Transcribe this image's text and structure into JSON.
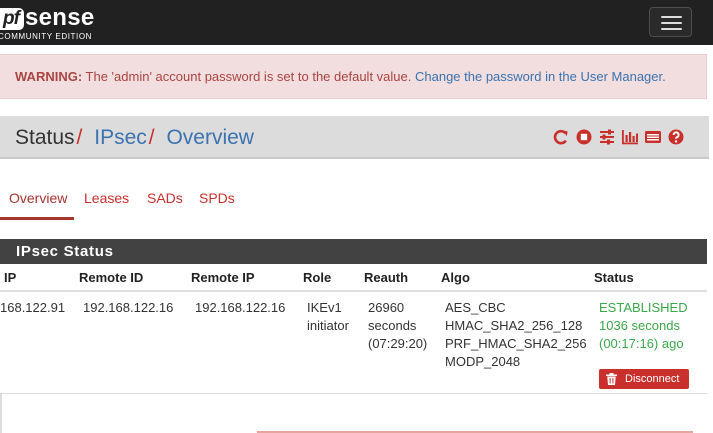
{
  "brand": {
    "logo_pf": "pf",
    "logo_sense": "sense",
    "edition": "COMMUNITY EDITION"
  },
  "alert": {
    "label": "WARNING:",
    "message": " The 'admin' account password is set to the default value. ",
    "link": "Change the password in the User Manager."
  },
  "breadcrumb": {
    "items": [
      "Status",
      "IPsec",
      "Overview"
    ],
    "separator": "/"
  },
  "toolbar": {
    "icons": [
      "reload-icon",
      "stop-icon",
      "sliders-icon",
      "bar-chart-icon",
      "log-icon",
      "help-icon"
    ],
    "color": "#c9302c"
  },
  "tabs": [
    {
      "label": "Overview",
      "active": true
    },
    {
      "label": "Leases",
      "active": false
    },
    {
      "label": "SADs",
      "active": false
    },
    {
      "label": "SPDs",
      "active": false
    }
  ],
  "panel": {
    "title": "IPsec Status",
    "columns": [
      "IP",
      "Remote ID",
      "Remote IP",
      "Role",
      "Reauth",
      "Algo",
      "Status"
    ],
    "rows": [
      {
        "ip": "168.122.91",
        "remote_id": "192.168.122.16",
        "remote_ip": "192.168.122.16",
        "role": [
          "IKEv1",
          "initiator"
        ],
        "reauth": [
          "26960",
          "seconds",
          "(07:29:20)"
        ],
        "algo": [
          "AES_CBC",
          "HMAC_SHA2_256_128",
          "PRF_HMAC_SHA2_256",
          "MODP_2048"
        ],
        "status": [
          "ESTABLISHED",
          "1036 seconds",
          "(00:17:16) ago"
        ],
        "action": "Disconnect"
      }
    ]
  },
  "colors": {
    "navbar": "#212121",
    "link": "#3a73b0",
    "danger": "#c9302c",
    "success": "#3aa948",
    "panel_heading": "#424242"
  }
}
